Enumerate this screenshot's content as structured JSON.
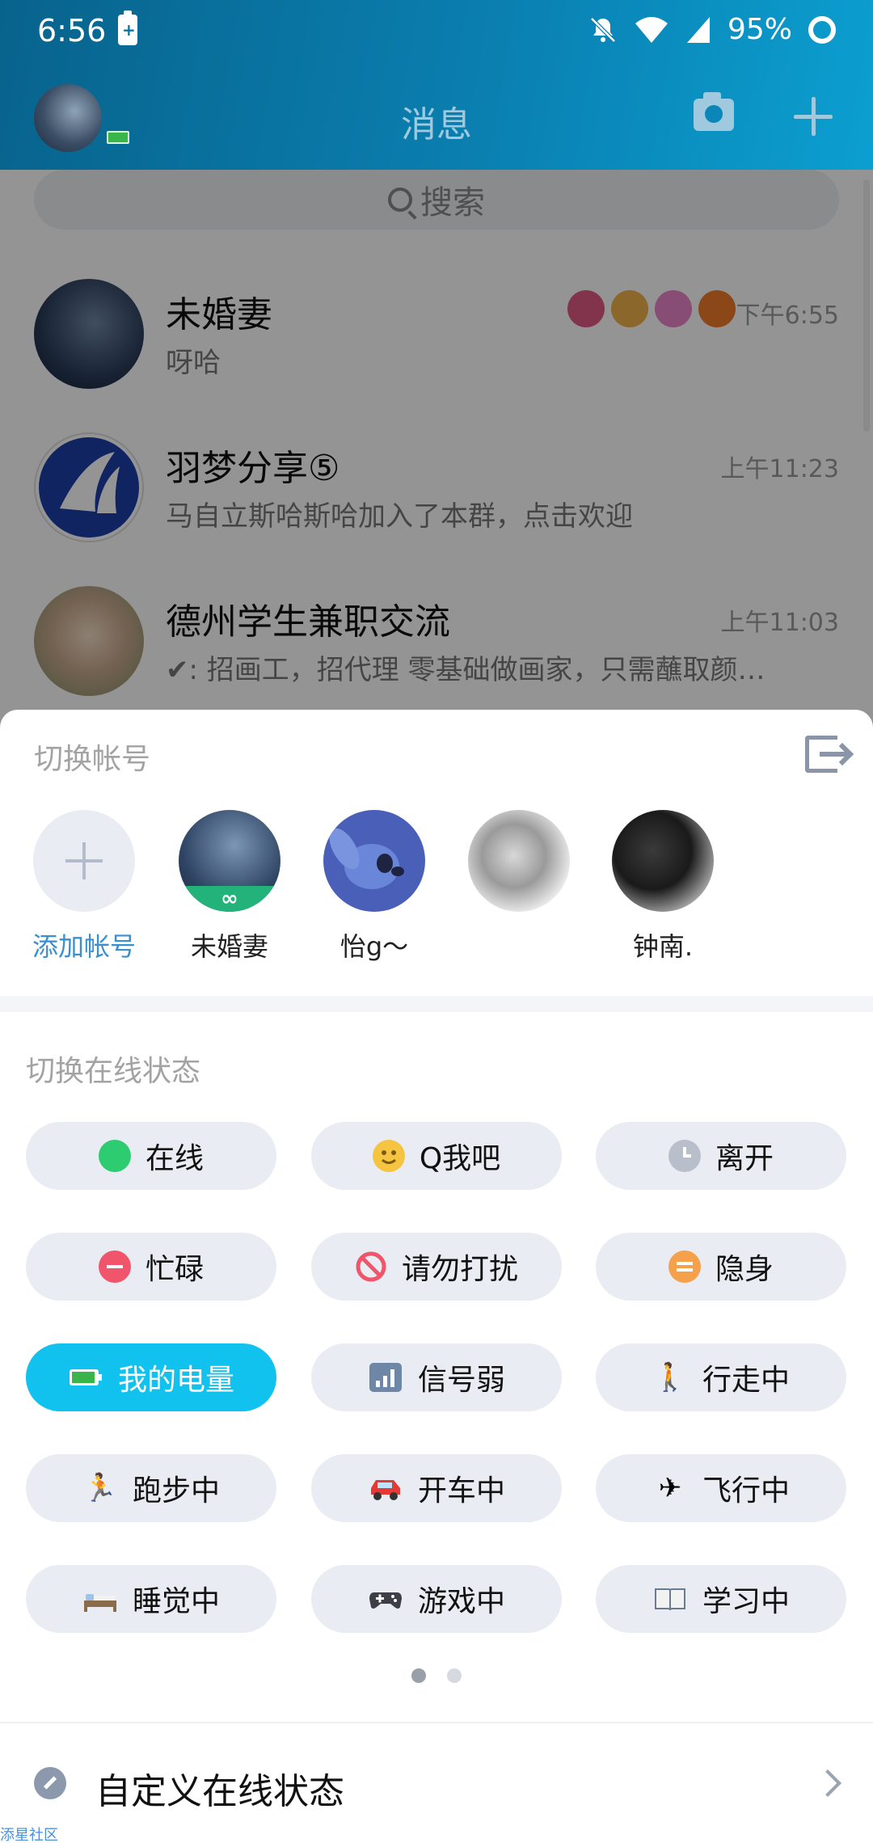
{
  "status_bar": {
    "time": "6:56",
    "battery_percent": "95%"
  },
  "header": {
    "title": "消息"
  },
  "search": {
    "placeholder": "搜索"
  },
  "chats": [
    {
      "name": "未婚妻",
      "preview": "呀哈",
      "time": "下午6:55"
    },
    {
      "name": "羽梦分享⑤",
      "preview": "马自立斯哈斯哈加入了本群，点击欢迎",
      "time": "上午11:23"
    },
    {
      "name": "德州学生兼职交流",
      "preview": "✔: 招画工，招代理  零基础做画家，只需蘸取颜…",
      "time": "上午11:03"
    }
  ],
  "accounts_sheet": {
    "title": "切换帐号",
    "add_label": "添加帐号",
    "accounts": [
      {
        "name": "未婚妻"
      },
      {
        "name": "怡g～"
      },
      {
        "name": ""
      },
      {
        "name": "钟南."
      }
    ]
  },
  "online_status": {
    "title": "切换在线状态",
    "options": [
      {
        "label": "在线",
        "icon": "online-icon",
        "color": "#2ecc71"
      },
      {
        "label": "Q我吧",
        "icon": "smile-icon",
        "color": "#f5c542"
      },
      {
        "label": "离开",
        "icon": "clock-icon",
        "color": "#b9bfca"
      },
      {
        "label": "忙碌",
        "icon": "busy-icon",
        "color": "#f0556b"
      },
      {
        "label": "请勿打扰",
        "icon": "no-disturb-icon",
        "color": "#f0556b"
      },
      {
        "label": "隐身",
        "icon": "invisible-icon",
        "color": "#f5a04a"
      },
      {
        "label": "我的电量",
        "icon": "battery-icon",
        "active": true
      },
      {
        "label": "信号弱",
        "icon": "signal-icon"
      },
      {
        "label": "行走中",
        "icon": "walking-icon"
      },
      {
        "label": "跑步中",
        "icon": "running-icon"
      },
      {
        "label": "开车中",
        "icon": "car-icon"
      },
      {
        "label": "飞行中",
        "icon": "airplane-icon"
      },
      {
        "label": "睡觉中",
        "icon": "bed-icon"
      },
      {
        "label": "游戏中",
        "icon": "gamepad-icon"
      },
      {
        "label": "学习中",
        "icon": "book-icon"
      }
    ],
    "page_count": 2,
    "current_page": 1
  },
  "custom_status": {
    "label": "自定义在线状态"
  },
  "watermark": "添星社区"
}
